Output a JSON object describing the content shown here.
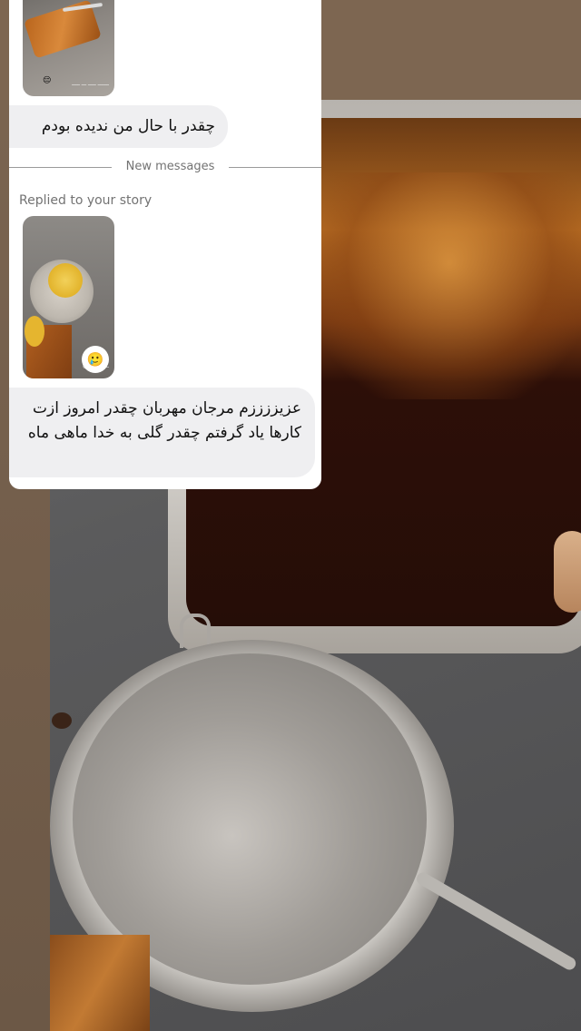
{
  "chat": {
    "story_thumb_1": {
      "caption": "ـــــــ ـــــ ـــ ـــــ",
      "emoji": "😔"
    },
    "message_1": "چقدر با حال من ندیده بودم",
    "divider_label": "New messages",
    "reply_label": "Replied to your story",
    "story_thumb_2": {
      "caption": "@ـــــــ.ـــــ",
      "reaction_emoji": "🥲"
    },
    "message_2": "عزیززززم مرجان مهربان چقدر امروز ازت کارها یاد گرفتم چقدر گلی به خدا ماهی ماه"
  },
  "colors": {
    "panel_bg": "#ffffff",
    "bubble_bg": "#efeff1",
    "meta_text": "#737373"
  }
}
